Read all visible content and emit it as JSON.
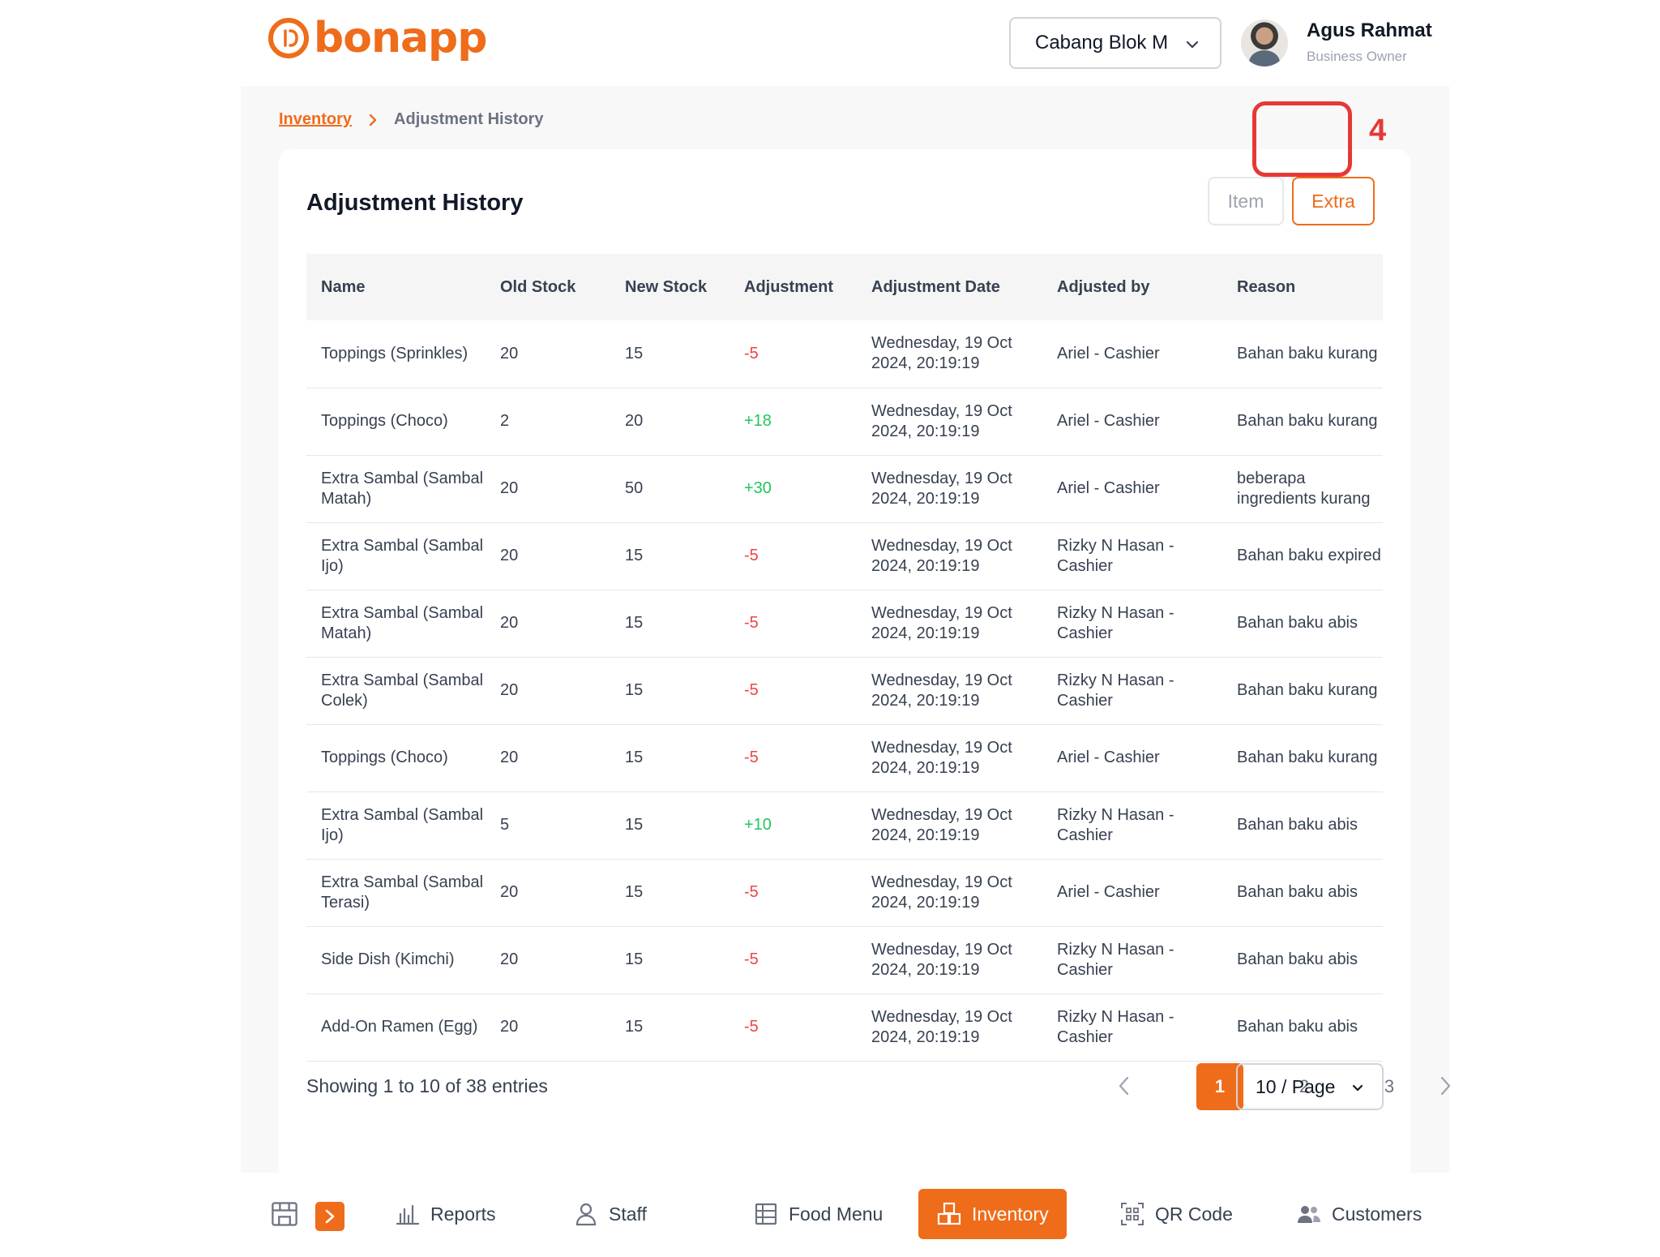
{
  "brand": {
    "name": "bonapp",
    "color": "#ef6c1a"
  },
  "header": {
    "branch": "Cabang Blok M",
    "user_name": "Agus Rahmat",
    "user_role": "Business Owner"
  },
  "breadcrumb": {
    "parent": "Inventory",
    "current": "Adjustment History"
  },
  "card": {
    "title": "Adjustment History",
    "tabs": {
      "item": "Item",
      "extra": "Extra"
    },
    "annotation": "4"
  },
  "table": {
    "headers": [
      "Name",
      "Old Stock",
      "New Stock",
      "Adjustment",
      "Adjustment Date",
      "Adjusted by",
      "Reason"
    ],
    "rows": [
      {
        "name": "Toppings (Sprinkles)",
        "old": "20",
        "new": "15",
        "adj": "-5",
        "date": "Wednesday, 19 Oct 2024, 20:19:19",
        "by": "Ariel - Cashier",
        "reason": "Bahan baku kurang"
      },
      {
        "name": "Toppings (Choco)",
        "old": "2",
        "new": "20",
        "adj": "+18",
        "date": "Wednesday, 19 Oct 2024, 20:19:19",
        "by": "Ariel - Cashier",
        "reason": "Bahan baku kurang"
      },
      {
        "name": "Extra Sambal (Sambal Matah)",
        "old": "20",
        "new": "50",
        "adj": "+30",
        "date": "Wednesday, 19 Oct 2024, 20:19:19",
        "by": "Ariel - Cashier",
        "reason": "beberapa ingredients kurang"
      },
      {
        "name": "Extra Sambal (Sambal Ijo)",
        "old": "20",
        "new": "15",
        "adj": "-5",
        "date": "Wednesday, 19 Oct 2024, 20:19:19",
        "by": "Rizky N Hasan - Cashier",
        "reason": "Bahan baku expired"
      },
      {
        "name": "Extra Sambal (Sambal Matah)",
        "old": "20",
        "new": "15",
        "adj": "-5",
        "date": "Wednesday, 19 Oct 2024, 20:19:19",
        "by": "Rizky N Hasan - Cashier",
        "reason": "Bahan baku abis"
      },
      {
        "name": "Extra Sambal (Sambal Colek)",
        "old": "20",
        "new": "15",
        "adj": "-5",
        "date": "Wednesday, 19 Oct 2024, 20:19:19",
        "by": "Rizky N Hasan - Cashier",
        "reason": "Bahan baku kurang"
      },
      {
        "name": "Toppings (Choco)",
        "old": "20",
        "new": "15",
        "adj": "-5",
        "date": "Wednesday, 19 Oct 2024, 20:19:19",
        "by": "Ariel - Cashier",
        "reason": "Bahan baku kurang"
      },
      {
        "name": "Extra Sambal (Sambal Ijo)",
        "old": "5",
        "new": "15",
        "adj": "+10",
        "date": "Wednesday, 19 Oct 2024, 20:19:19",
        "by": "Rizky N Hasan - Cashier",
        "reason": "Bahan baku abis"
      },
      {
        "name": "Extra Sambal (Sambal Terasi)",
        "old": "20",
        "new": "15",
        "adj": "-5",
        "date": "Wednesday, 19 Oct 2024, 20:19:19",
        "by": "Ariel - Cashier",
        "reason": "Bahan baku abis"
      },
      {
        "name": "Side Dish (Kimchi)",
        "old": "20",
        "new": "15",
        "adj": "-5",
        "date": "Wednesday, 19 Oct 2024, 20:19:19",
        "by": "Rizky N Hasan - Cashier",
        "reason": "Bahan baku abis"
      },
      {
        "name": "Add-On Ramen (Egg)",
        "old": "20",
        "new": "15",
        "adj": "-5",
        "date": "Wednesday, 19 Oct 2024, 20:19:19",
        "by": "Rizky N Hasan - Cashier",
        "reason": "Bahan baku abis"
      }
    ]
  },
  "pagination": {
    "showing": "Showing 1 to 10 of 38 entries",
    "pages": [
      "1",
      "2",
      "3"
    ],
    "active_page": "1",
    "page_size": "10 / Page"
  },
  "bottom_nav": {
    "items": [
      {
        "label": "Reports",
        "icon": "bar-chart-icon"
      },
      {
        "label": "Staff",
        "icon": "user-icon"
      },
      {
        "label": "Food Menu",
        "icon": "menu-grid-icon"
      },
      {
        "label": "Inventory",
        "icon": "inventory-icon",
        "active": true
      },
      {
        "label": "QR Code",
        "icon": "qr-code-icon"
      },
      {
        "label": "Customers",
        "icon": "customers-icon"
      }
    ]
  },
  "colors": {
    "accent": "#ef6c1a",
    "negative": "#ef4444",
    "positive": "#22c55e",
    "annotation": "#e53935"
  }
}
